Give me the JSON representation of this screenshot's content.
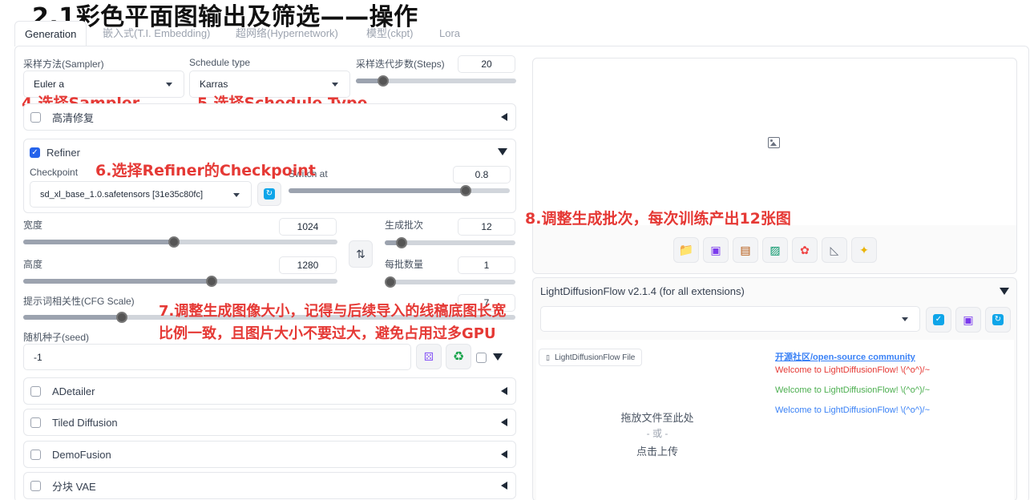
{
  "page_title": "2.1彩色平面图输出及筛选——操作",
  "tabs": [
    "Generation",
    "嵌入式(T.I. Embedding)",
    "超网络(Hypernetwork)",
    "模型(ckpt)",
    "Lora"
  ],
  "sampler": {
    "label": "采样方法(Sampler)",
    "value": "Euler a"
  },
  "schedule": {
    "label": "Schedule type",
    "value": "Karras"
  },
  "steps": {
    "label": "采样迭代步数(Steps)",
    "value": "20",
    "fraction": 0.17
  },
  "hires": {
    "label": "高清修复"
  },
  "refiner": {
    "label": "Refiner",
    "checkpoint_label": "Checkpoint",
    "checkpoint_value": "sd_xl_base_1.0.safetensors [31e35c80fc]",
    "switch_label": "Switch at",
    "switch_value": "0.8",
    "switch_fraction": 0.8
  },
  "width": {
    "label": "宽度",
    "value": "1024",
    "fraction": 0.48
  },
  "height": {
    "label": "高度",
    "value": "1280",
    "fraction": 0.6
  },
  "batch_count": {
    "label": "生成批次",
    "value": "12",
    "fraction": 0.13
  },
  "batch_size": {
    "label": "每批数量",
    "value": "1",
    "fraction": 0.0
  },
  "cfg": {
    "label": "提示词相关性(CFG Scale)",
    "value": "7",
    "fraction": 0.2
  },
  "seed": {
    "label": "随机种子(seed)",
    "value": "-1"
  },
  "accordions": [
    "ADetailer",
    "Tiled Diffusion",
    "DemoFusion",
    "分块 VAE"
  ],
  "annotations": {
    "a4": "4.选择Sampler",
    "a5": "5.选择Schedule Type",
    "a6": "6.选择Refiner的Checkpoint",
    "a7_line1": "7.调整生成图像大小，记得与后续导入的线稿底图长宽",
    "a7_line2": "比例一致，且图片大小不要过大，避免占用过多GPU",
    "a8": "8.调整生成批次，每次训练产出12张图"
  },
  "output_toolbar_icons": [
    "folder-icon",
    "save-icon",
    "zip-icon",
    "image-icon",
    "palette-icon",
    "ruler-icon",
    "sparkle-icon"
  ],
  "ldf": {
    "title": "LightDiffusionFlow v2.1.4 (for all extensions)",
    "file_label": "LightDiffusionFlow File",
    "community_link": "开源社区/open-source community",
    "welcome_red": "Welcome to LightDiffusionFlow! \\(^o^)/~",
    "welcome_green": "Welcome to LightDiffusionFlow! \\(^o^)/~",
    "welcome_blue": "Welcome to LightDiffusionFlow! \\(^o^)/~",
    "drop_line1": "拖放文件至此处",
    "drop_or": "- 或 -",
    "drop_line2": "点击上传"
  },
  "colors": {
    "accent": "#2563eb",
    "annotation": "#e53935",
    "welcome_red": "#e53935",
    "welcome_green": "#4caf50",
    "welcome_blue": "#3b82f6"
  }
}
